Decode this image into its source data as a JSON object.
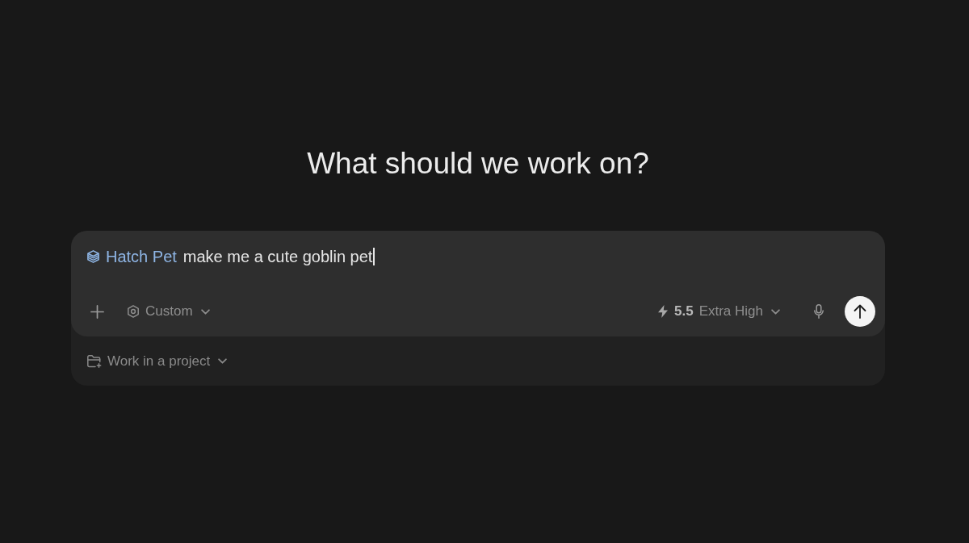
{
  "heading": "What should we work on?",
  "composer": {
    "skill_chip": {
      "label": "Hatch Pet"
    },
    "prompt": {
      "value": "make me a cute goblin pet"
    },
    "mode_dropdown": {
      "label": "Custom"
    },
    "model_dropdown": {
      "version": "5.5",
      "effort": "Extra High"
    }
  },
  "project_dropdown": {
    "label": "Work in a project"
  }
}
